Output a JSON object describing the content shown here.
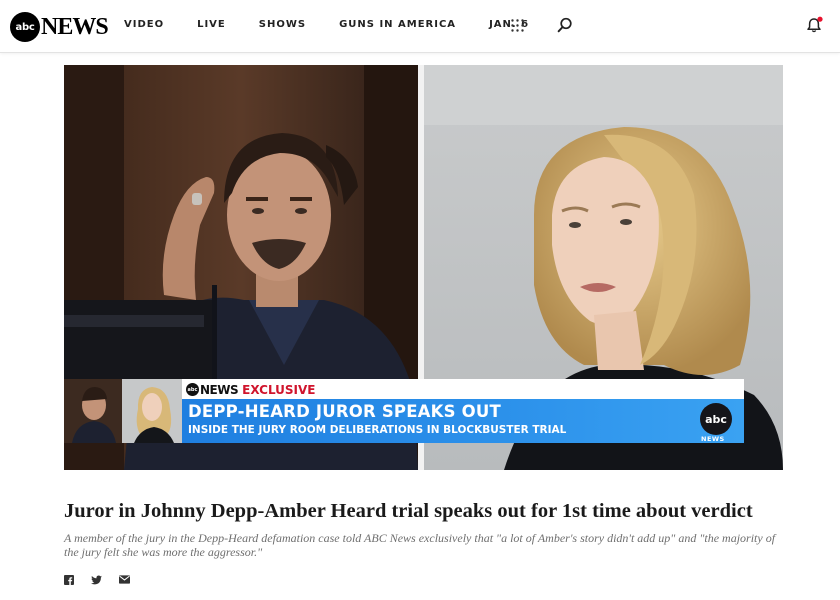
{
  "header": {
    "logo_mark": "abc",
    "logo_word": "NEWS",
    "nav": [
      "VIDEO",
      "LIVE",
      "SHOWS",
      "GUNS IN AMERICA",
      "JAN. 6"
    ],
    "icons": [
      "grid-menu-icon",
      "search-icon",
      "notification-bell-icon"
    ],
    "notification_dot_color": "#e8112d"
  },
  "hero": {
    "banner": {
      "network_mark": "abc",
      "network": "NEWS",
      "tag": "EXCLUSIVE",
      "headline": "DEPP-HEARD JUROR SPEAKS OUT",
      "subhead": "INSIDE THE JURY ROOM DELIBERATIONS IN BLOCKBUSTER TRIAL",
      "logo_mark": "abc",
      "logo_word": "NEWS",
      "accent_color": "#d0142c",
      "band_color": "#2b90ea"
    }
  },
  "article": {
    "headline": "Juror in Johnny Depp-Amber Heard trial speaks out for 1st time about verdict",
    "dek": "A member of the jury in the Depp-Heard defamation case told ABC News exclusively that \"a lot of Amber's story didn't add up\" and \"the majority of the jury felt she was more the aggressor.\"",
    "share_icons": [
      "facebook-icon",
      "twitter-icon",
      "email-icon"
    ]
  }
}
